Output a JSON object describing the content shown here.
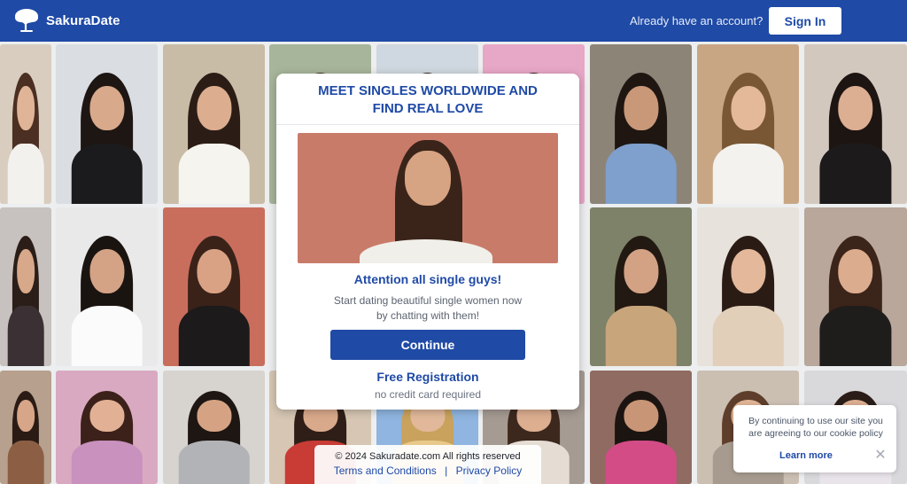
{
  "header": {
    "brand": "SakuraDate",
    "already_text": "Already have an account?",
    "signin_label": "Sign In",
    "logo_icon": "tree-icon",
    "color": "#1f4aa6"
  },
  "modal": {
    "title_line1": "MEET SINGLES WORLDWIDE AND",
    "title_line2": "FIND REAL LOVE",
    "attention": "Attention all single guys!",
    "desc_line1": "Start dating beautiful single women now",
    "desc_line2": "by chatting with them!",
    "continue_label": "Continue",
    "free_registration": "Free Registration",
    "no_credit": "no credit card required"
  },
  "footer": {
    "copyright": "© 2024 Sakuradate.com All rights reserved",
    "terms": "Terms and Conditions",
    "separator": "|",
    "privacy": "Privacy Policy"
  },
  "cookie": {
    "text_line1": "By continuing to use our site you",
    "text_line2": "are agreeing to our cookie policy",
    "learn_more": "Learn more",
    "close_icon": "close-icon"
  }
}
